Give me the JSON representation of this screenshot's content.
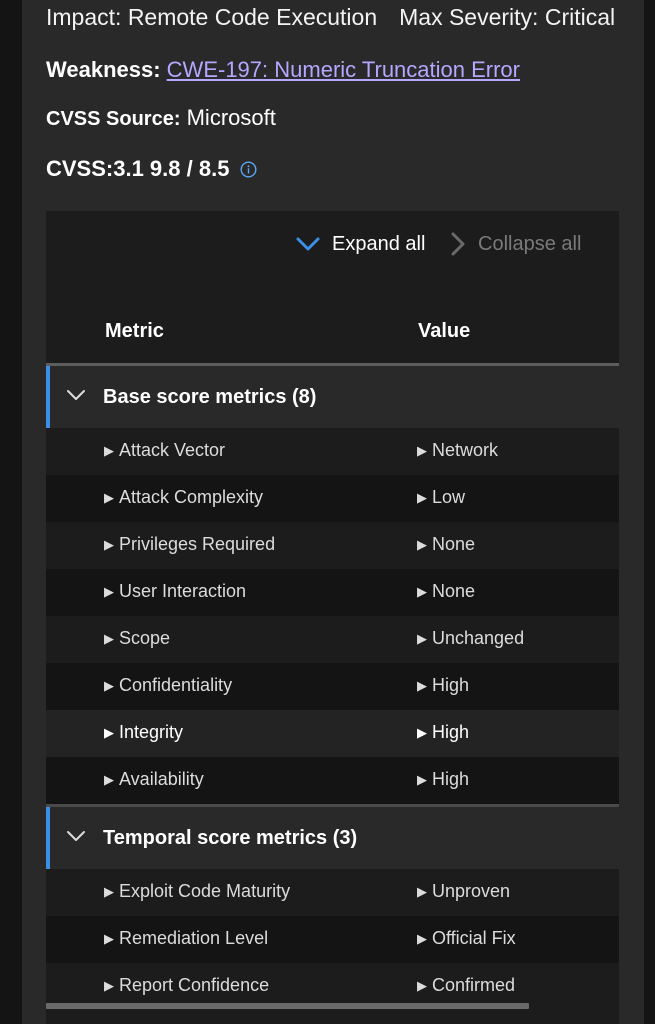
{
  "details": {
    "impact_label": "Impact:",
    "impact_value": "Remote Code Execution",
    "severity_label": "Max Severity:",
    "severity_value": "Critical",
    "weakness_label": "Weakness:",
    "weakness_link": "CWE-197: Numeric Truncation Error",
    "cvss_source_label": "CVSS Source:",
    "cvss_source_value": "Microsoft",
    "cvss_score": "CVSS:3.1 9.8 / 8.5",
    "info_icon": "info-circle-icon"
  },
  "toolbar": {
    "expand_label": "Expand all",
    "collapse_label": "Collapse all"
  },
  "table": {
    "headers": {
      "metric": "Metric",
      "value": "Value"
    },
    "groups": [
      {
        "label": "Base score metrics (8)",
        "rows": [
          {
            "metric": "Attack Vector",
            "value": "Network"
          },
          {
            "metric": "Attack Complexity",
            "value": "Low"
          },
          {
            "metric": "Privileges Required",
            "value": "None"
          },
          {
            "metric": "User Interaction",
            "value": "None"
          },
          {
            "metric": "Scope",
            "value": "Unchanged"
          },
          {
            "metric": "Confidentiality",
            "value": "High"
          },
          {
            "metric": "Integrity",
            "value": "High"
          },
          {
            "metric": "Availability",
            "value": "High"
          }
        ]
      },
      {
        "label": "Temporal score metrics (3)",
        "rows": [
          {
            "metric": "Exploit Code Maturity",
            "value": "Unproven"
          },
          {
            "metric": "Remediation Level",
            "value": "Official Fix"
          },
          {
            "metric": "Report Confidence",
            "value": "Confirmed"
          }
        ]
      }
    ]
  },
  "colors": {
    "accent": "#3d8ee8",
    "link": "#b4a7ff",
    "panel": "#292929",
    "table_bg": "#1c1c1c"
  }
}
